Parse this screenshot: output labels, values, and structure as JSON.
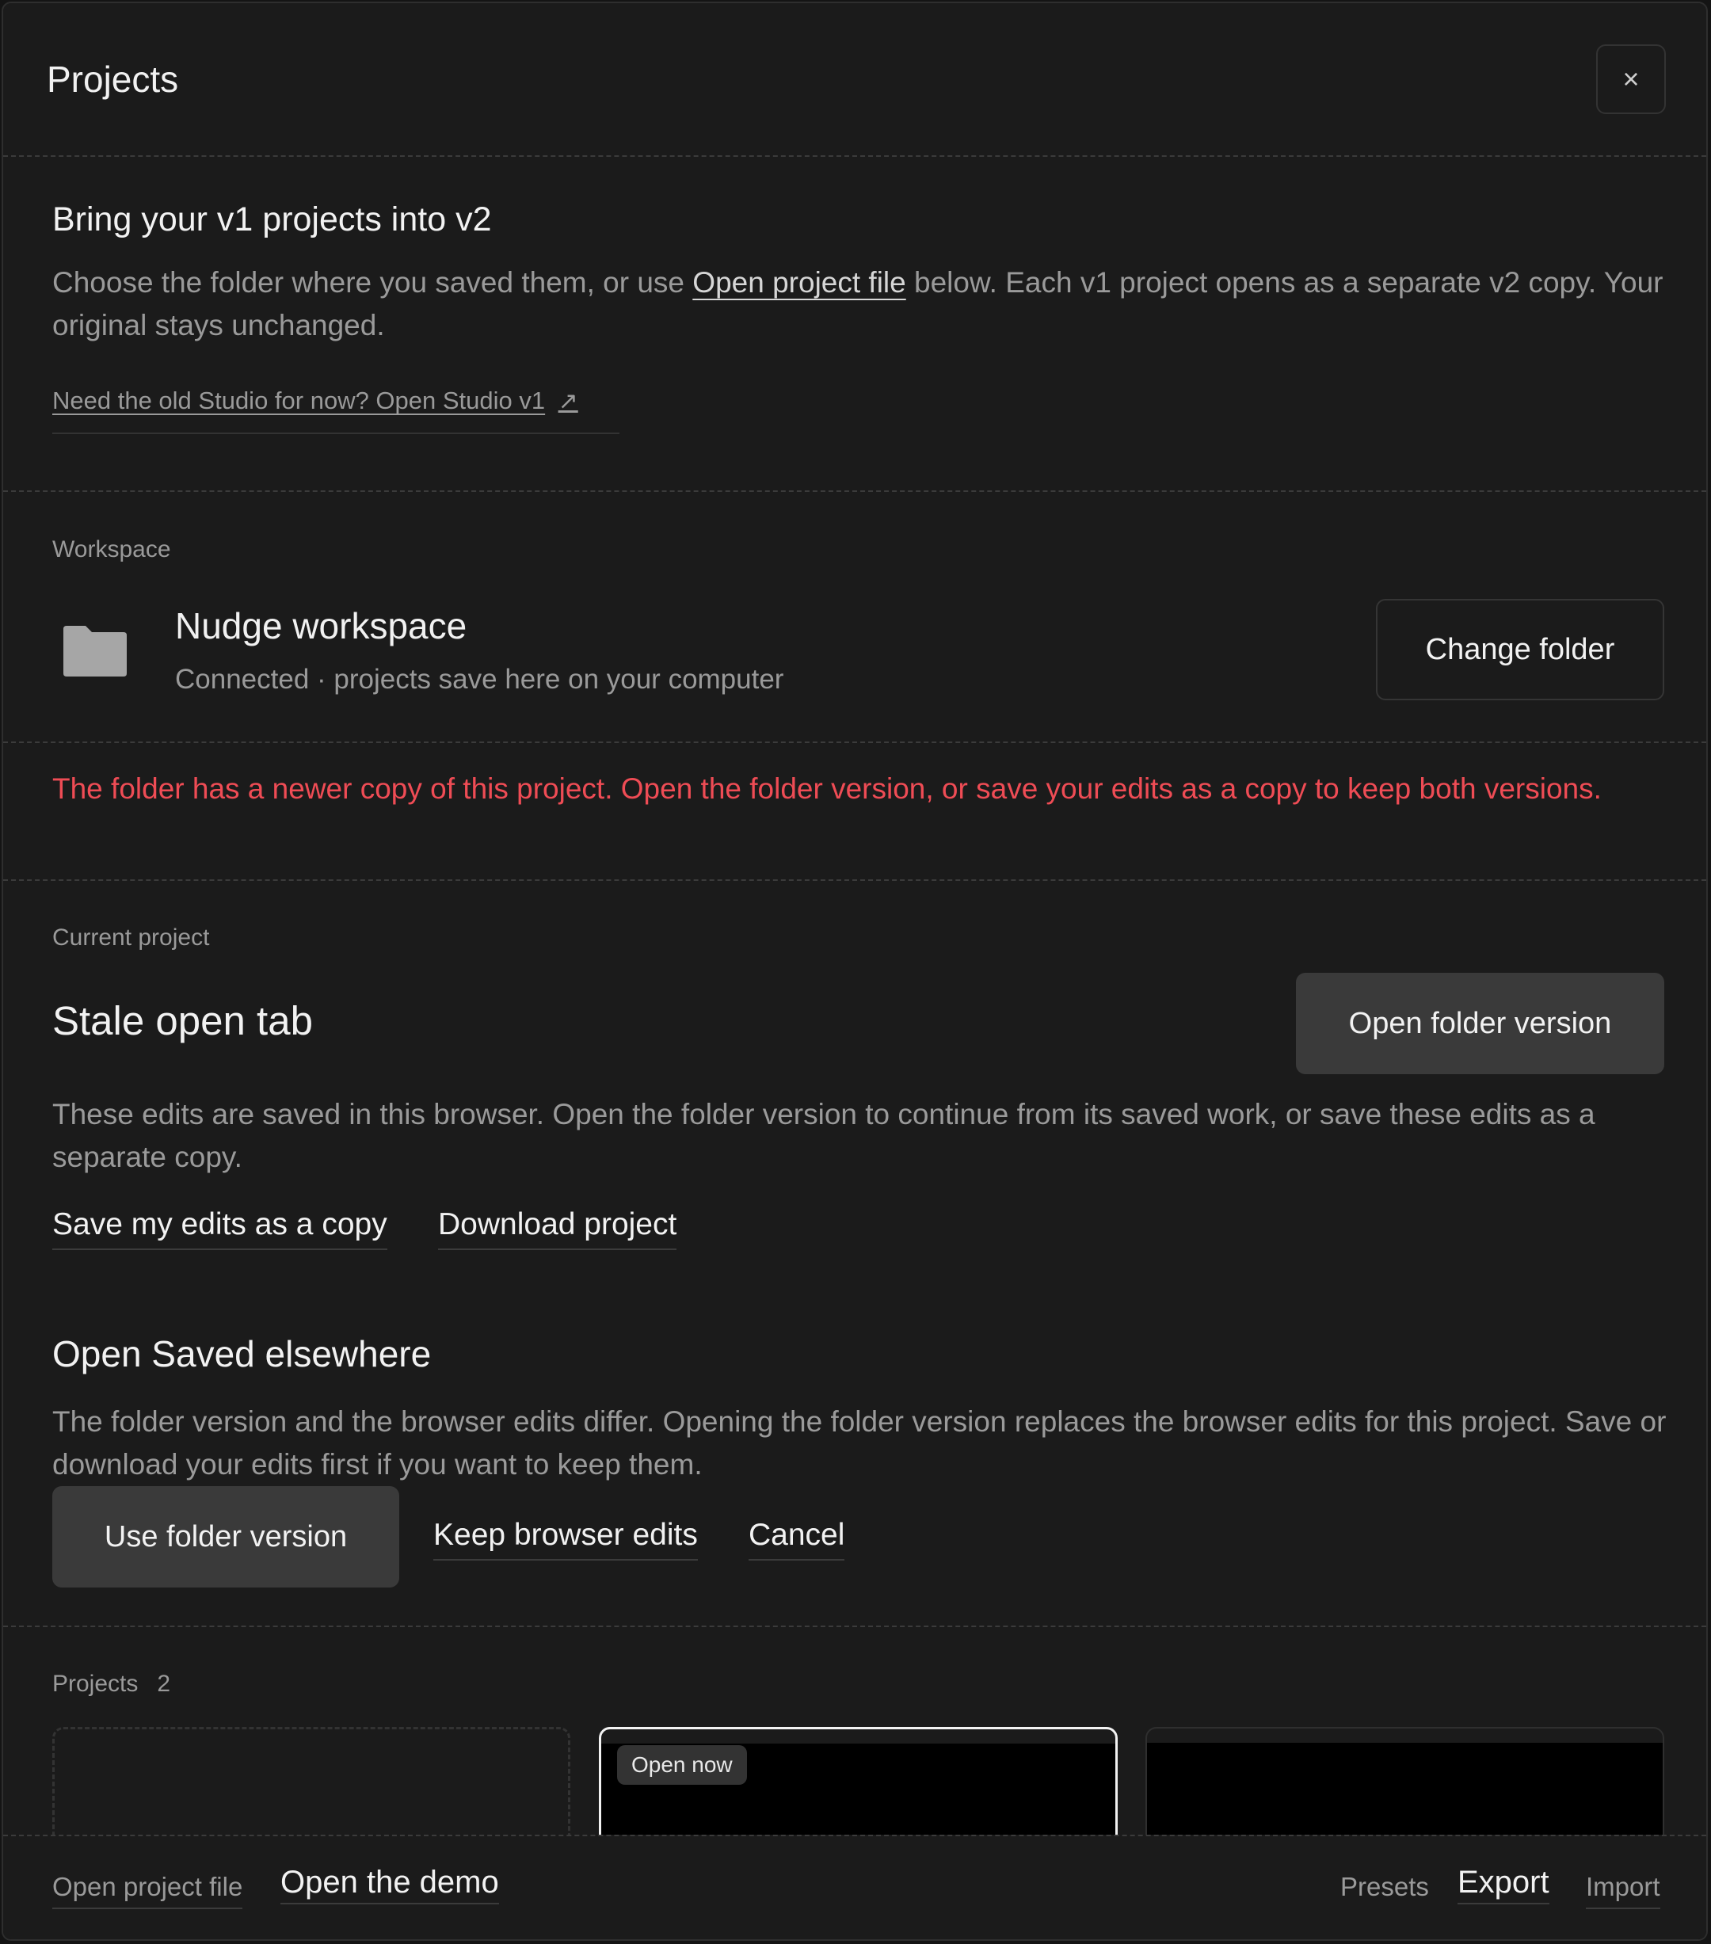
{
  "dialog": {
    "title": "Projects",
    "close_label": "×"
  },
  "migrate": {
    "heading": "Bring your v1 projects into v2",
    "desc_prefix": "Choose the folder where you saved them, or use ",
    "desc_link": "Open project file",
    "desc_suffix": " below. Each v1 project opens as a separate v2 copy. Your original stays unchanged.",
    "old_studio_link": "Need the old Studio for now? Open Studio v1",
    "external_icon": "↗"
  },
  "workspace": {
    "section_label": "Workspace",
    "icon": "folder-icon",
    "name": "Nudge workspace",
    "status": "Connected · projects save here on your computer",
    "change_button": "Change folder"
  },
  "warning": {
    "text": "The folder has a newer copy of this project. Open the folder version, or save your edits as a copy to keep both versions.",
    "color": "#ef4c55"
  },
  "current_project": {
    "section_label": "Current project",
    "name": "Stale open tab",
    "open_folder_button": "Open folder version",
    "description": "These edits are saved in this browser. Open the folder version to continue from its saved work, or save these edits as a separate copy.",
    "save_copy_link": "Save my edits as a copy",
    "download_link": "Download project"
  },
  "saved_elsewhere": {
    "heading": "Open Saved elsewhere",
    "description": "The folder version and the browser edits differ. Opening the folder version replaces the browser edits for this project. Save or download your edits first if you want to keep them.",
    "use_folder_button": "Use folder version",
    "keep_browser_link": "Keep browser edits",
    "cancel_link": "Cancel"
  },
  "projects": {
    "section_label": "Projects",
    "count": "2",
    "cards": [
      {
        "kind": "new"
      },
      {
        "kind": "project",
        "badge": "Open now"
      },
      {
        "kind": "project"
      }
    ]
  },
  "footer": {
    "open_file": "Open project file",
    "open_demo": "Open the demo",
    "presets": "Presets",
    "export": "Export",
    "import": "Import"
  }
}
